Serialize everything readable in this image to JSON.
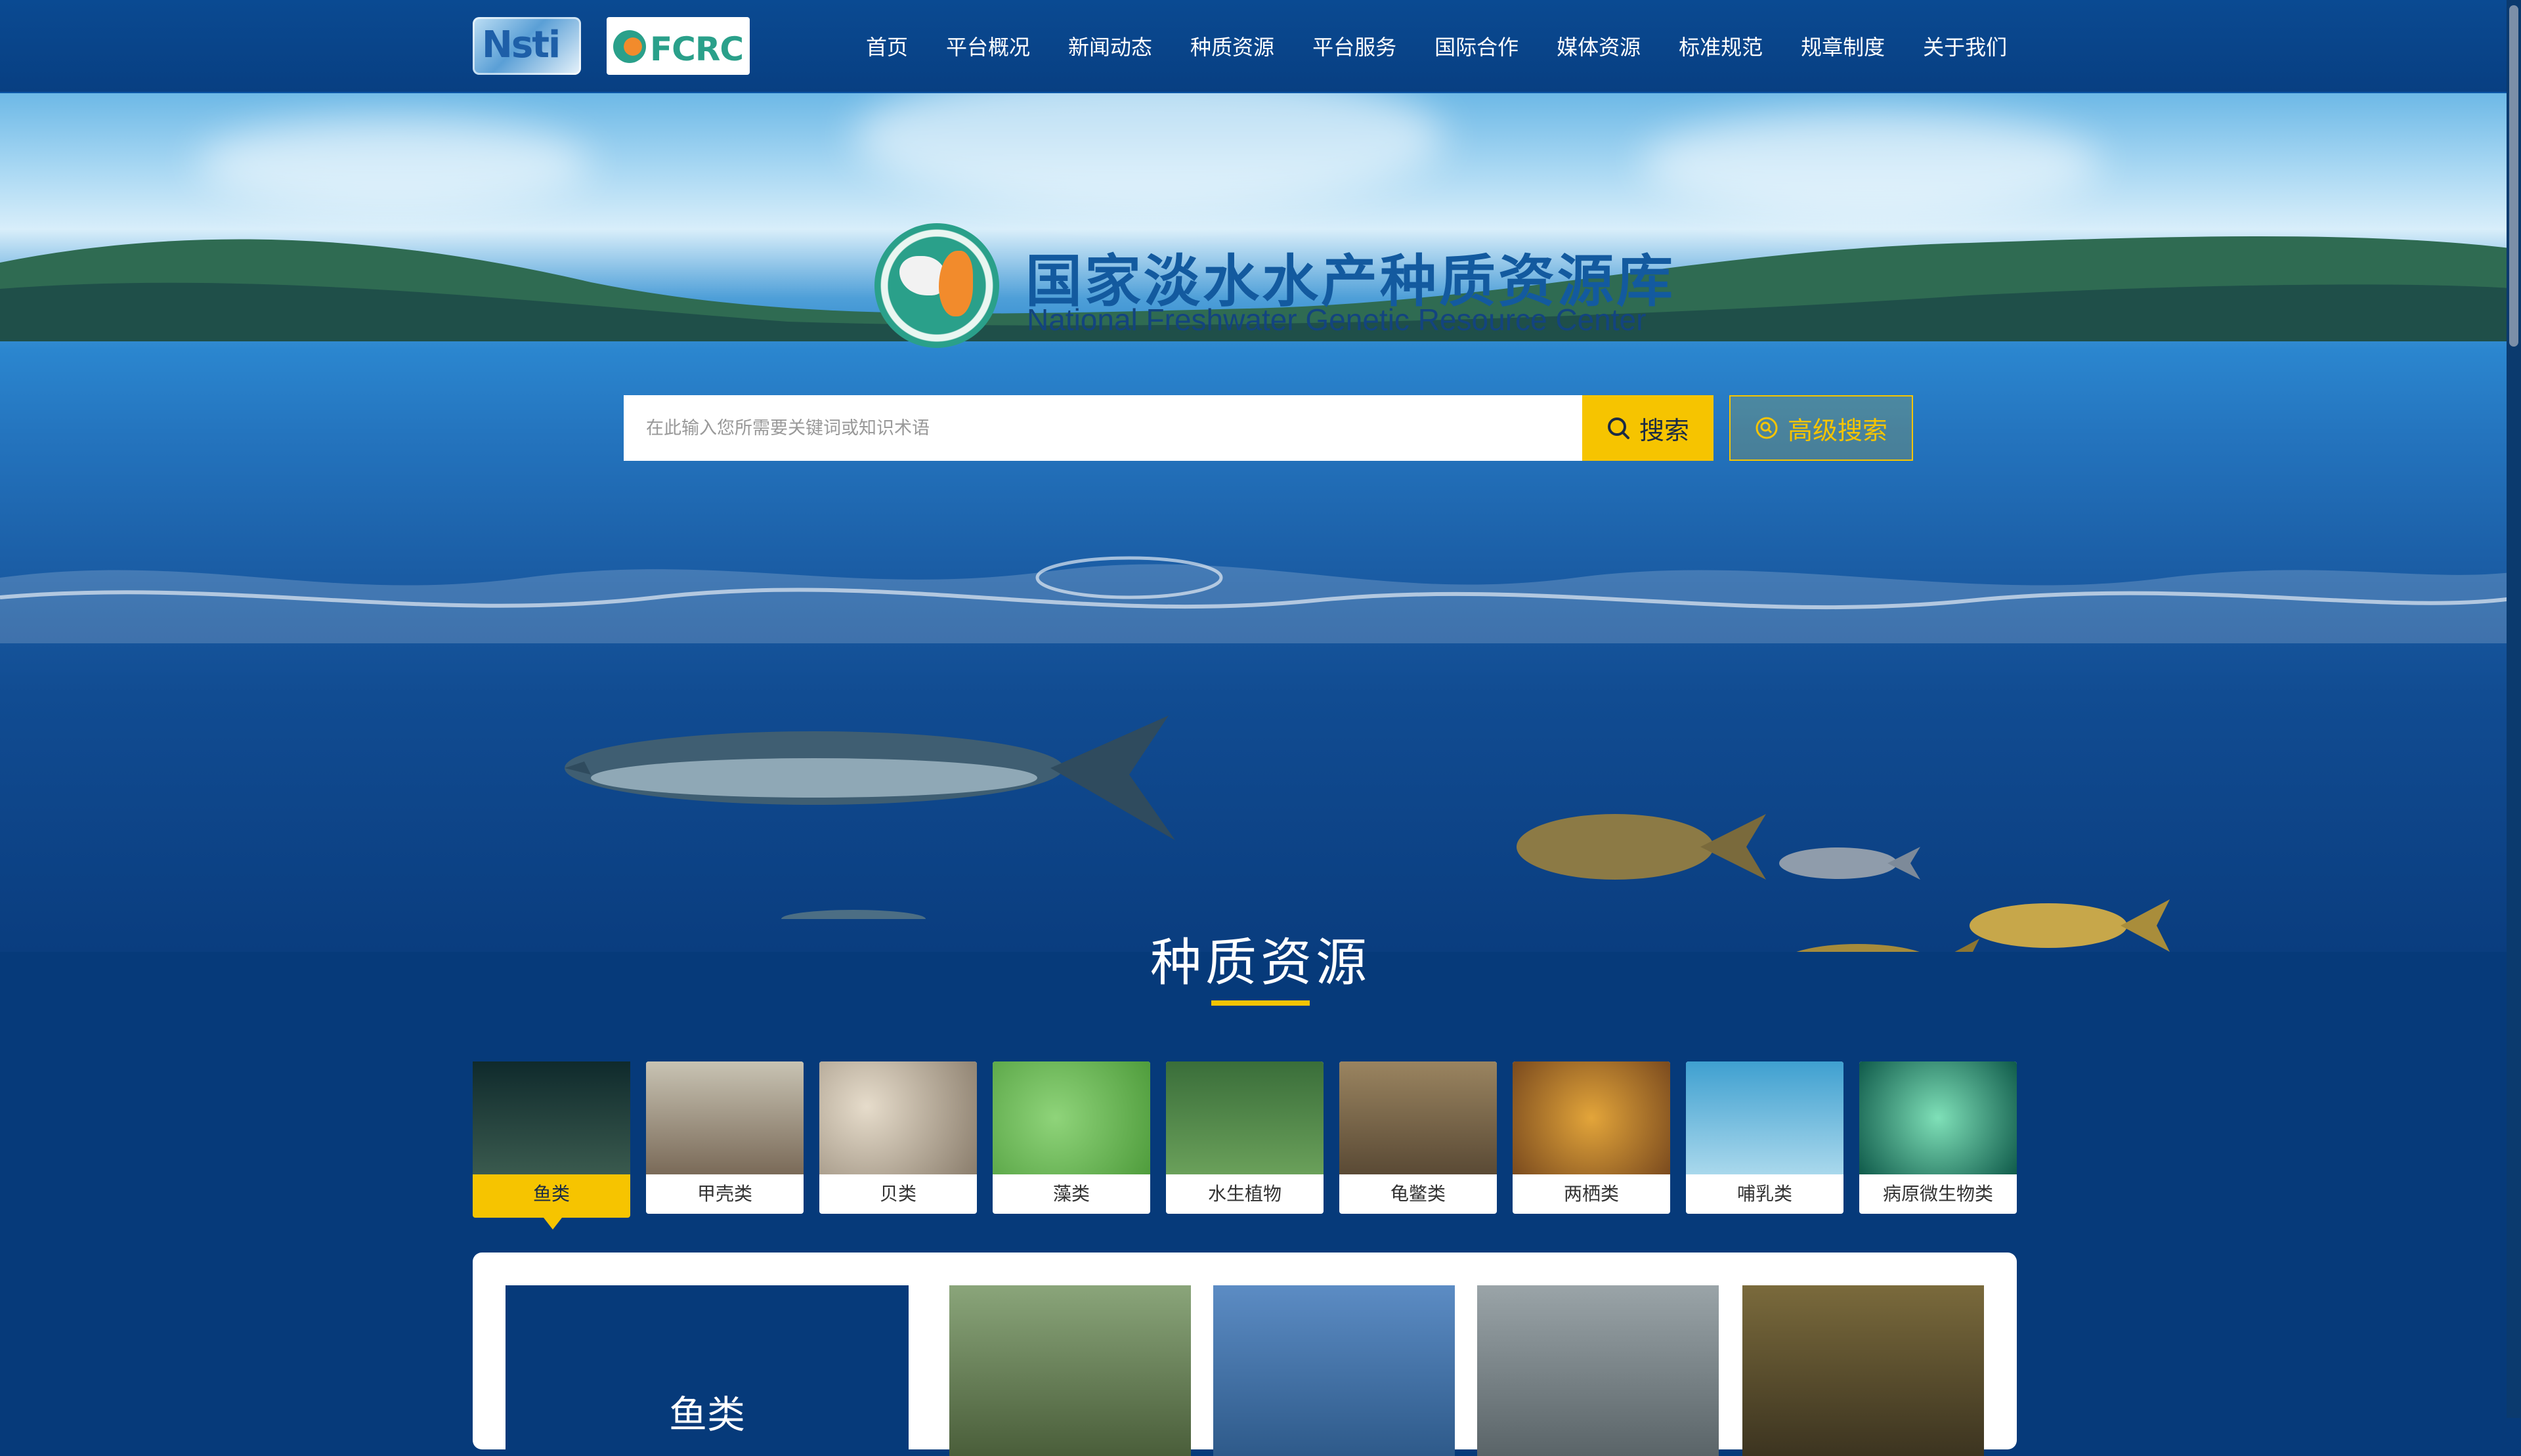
{
  "nav": {
    "logos": [
      "Nsti",
      "FCRC"
    ],
    "items": [
      "首页",
      "平台概况",
      "新闻动态",
      "种质资源",
      "平台服务",
      "国际合作",
      "媒体资源",
      "标准规范",
      "规章制度",
      "关于我们"
    ]
  },
  "hero": {
    "title_cn": "国家淡水水产种质资源库",
    "title_en": "National Freshwater Genetic Resource Center",
    "search_placeholder": "在此输入您所需要关键词或知识术语",
    "search_label": "搜索",
    "advanced_label": "高级搜索"
  },
  "section": {
    "title": "种质资源",
    "categories": [
      {
        "label": "鱼类",
        "active": true,
        "icon": "fish-photo"
      },
      {
        "label": "甲壳类",
        "icon": "crab-photo"
      },
      {
        "label": "贝类",
        "icon": "clam-photo"
      },
      {
        "label": "藻类",
        "icon": "algae-photo"
      },
      {
        "label": "水生植物",
        "icon": "aquatic-plant-photo"
      },
      {
        "label": "龟鳖类",
        "icon": "turtle-photo"
      },
      {
        "label": "两栖类",
        "icon": "frog-photo"
      },
      {
        "label": "哺乳类",
        "icon": "dolphin-photo"
      },
      {
        "label": "病原微生物类",
        "icon": "microbe-photo"
      }
    ]
  },
  "panel": {
    "tile_title": "鱼类"
  },
  "colors": {
    "nav_bg": "#0a4a92",
    "accent": "#f6c400",
    "page_bg": "#063a7a"
  }
}
